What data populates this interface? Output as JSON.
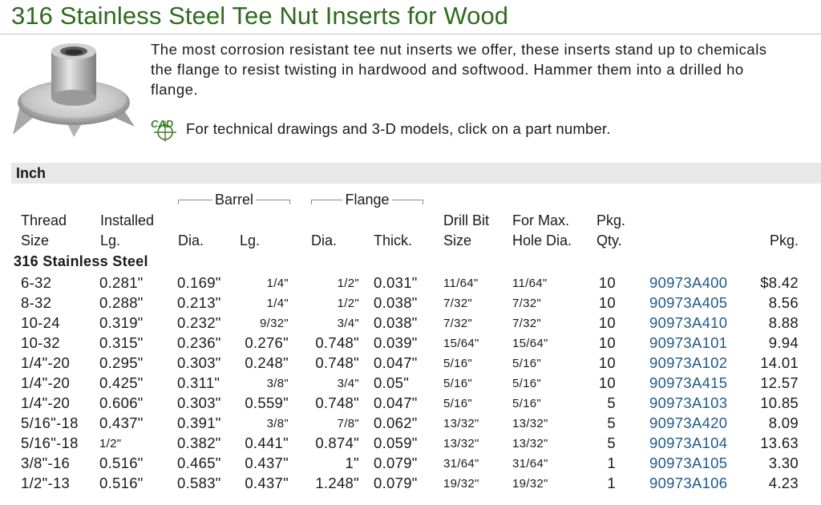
{
  "page": {
    "title": "316 Stainless Steel Tee Nut Inserts for Wood",
    "description": "The most corrosion resistant tee nut inserts we offer, these inserts stand up to chemicals\nthe flange to resist twisting in hardwood and softwood. Hammer them into a drilled ho\nflange.",
    "cad_note": "For technical drawings and 3-D models, click on a part number."
  },
  "table": {
    "section_title": "Inch",
    "group_barrel": "Barrel",
    "group_flange": "Flange",
    "headers": {
      "thread_size": "Thread\nSize",
      "installed_lg": "Installed\nLg.",
      "barrel_dia": "Dia.",
      "barrel_lg": "Lg.",
      "flange_dia": "Dia.",
      "flange_thick": "Thick.",
      "drill_bit": "Drill Bit\nSize",
      "max_hole": "For Max.\nHole Dia.",
      "pkg_qty": "Pkg.\nQty.",
      "pkg": "Pkg."
    },
    "material_label": "316 Stainless Steel",
    "rows": [
      {
        "thread": "6-32",
        "installed": "0.281\"",
        "bdia": "0.169\"",
        "blg": "1/4\"",
        "fdia": "1/2\"",
        "fthick": "0.031\"",
        "drill": "11/64\"",
        "maxhole": "11/64\"",
        "qty": "10",
        "part": "90973A400",
        "price": "$8.42"
      },
      {
        "thread": "8-32",
        "installed": "0.288\"",
        "bdia": "0.213\"",
        "blg": "1/4\"",
        "fdia": "1/2\"",
        "fthick": "0.038\"",
        "drill": "7/32\"",
        "maxhole": "7/32\"",
        "qty": "10",
        "part": "90973A405",
        "price": "8.56"
      },
      {
        "thread": "10-24",
        "installed": "0.319\"",
        "bdia": "0.232\"",
        "blg": "9/32\"",
        "fdia": "3/4\"",
        "fthick": "0.038\"",
        "drill": "7/32\"",
        "maxhole": "7/32\"",
        "qty": "10",
        "part": "90973A410",
        "price": "8.88"
      },
      {
        "thread": "10-32",
        "installed": "0.315\"",
        "bdia": "0.236\"",
        "blg": "0.276\"",
        "fdia": "0.748\"",
        "fthick": "0.039\"",
        "drill": "15/64\"",
        "maxhole": "15/64\"",
        "qty": "10",
        "part": "90973A101",
        "price": "9.94"
      },
      {
        "thread": "1/4\"-20",
        "installed": "0.295\"",
        "bdia": "0.303\"",
        "blg": "0.248\"",
        "fdia": "0.748\"",
        "fthick": "0.047\"",
        "drill": "5/16\"",
        "maxhole": "5/16\"",
        "qty": "10",
        "part": "90973A102",
        "price": "14.01"
      },
      {
        "thread": "1/4\"-20",
        "installed": "0.425\"",
        "bdia": "0.311\"",
        "blg": "3/8\"",
        "fdia": "3/4\"",
        "fthick": "0.05\"",
        "drill": "5/16\"",
        "maxhole": "5/16\"",
        "qty": "10",
        "part": "90973A415",
        "price": "12.57"
      },
      {
        "thread": "1/4\"-20",
        "installed": "0.606\"",
        "bdia": "0.303\"",
        "blg": "0.559\"",
        "fdia": "0.748\"",
        "fthick": "0.047\"",
        "drill": "5/16\"",
        "maxhole": "5/16\"",
        "qty": "5",
        "part": "90973A103",
        "price": "10.85"
      },
      {
        "thread": "5/16\"-18",
        "installed": "0.437\"",
        "bdia": "0.391\"",
        "blg": "3/8\"",
        "fdia": "7/8\"",
        "fthick": "0.062\"",
        "drill": "13/32\"",
        "maxhole": "13/32\"",
        "qty": "5",
        "part": "90973A420",
        "price": "8.09"
      },
      {
        "thread": "5/16\"-18",
        "installed": "1/2\"",
        "bdia": "0.382\"",
        "blg": "0.441\"",
        "fdia": "0.874\"",
        "fthick": "0.059\"",
        "drill": "13/32\"",
        "maxhole": "13/32\"",
        "qty": "5",
        "part": "90973A104",
        "price": "13.63"
      },
      {
        "thread": "3/8\"-16",
        "installed": "0.516\"",
        "bdia": "0.465\"",
        "blg": "0.437\"",
        "fdia": "1\"",
        "fthick": "0.079\"",
        "drill": "31/64\"",
        "maxhole": "31/64\"",
        "qty": "1",
        "part": "90973A105",
        "price": "3.30"
      },
      {
        "thread": "1/2\"-13",
        "installed": "0.516\"",
        "bdia": "0.583\"",
        "blg": "0.437\"",
        "fdia": "1.248\"",
        "fthick": "0.079\"",
        "drill": "19/32\"",
        "maxhole": "19/32\"",
        "qty": "1",
        "part": "90973A106",
        "price": "4.23"
      }
    ]
  },
  "colors": {
    "title": "#2e6b1e",
    "link": "#1f5a8c",
    "section_bg": "#e8e8e8"
  },
  "icons": {
    "cad": "cad-icon",
    "product": "tee-nut-product-image"
  }
}
